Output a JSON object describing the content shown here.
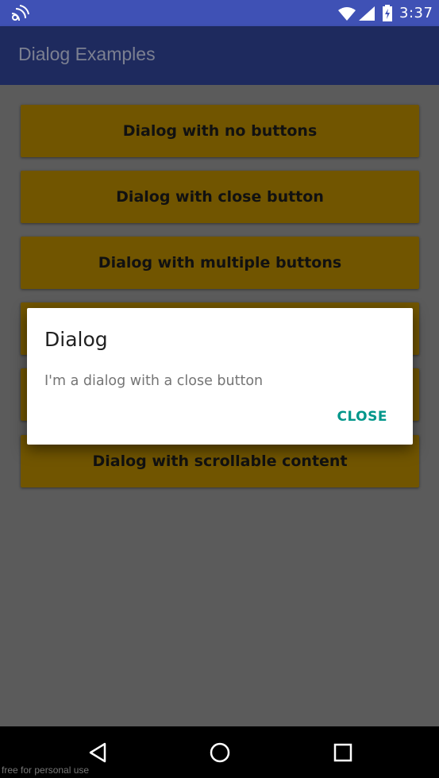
{
  "status_bar": {
    "time": "3:37",
    "icons": [
      "cast-icon",
      "wifi-icon",
      "signal-icon",
      "battery-icon"
    ]
  },
  "app_bar": {
    "title": "Dialog Examples"
  },
  "buttons": [
    {
      "label": "Dialog with no buttons"
    },
    {
      "label": "Dialog with close button"
    },
    {
      "label": "Dialog with multiple buttons"
    },
    {
      "label": ""
    },
    {
      "label": ""
    },
    {
      "label": "Dialog with scrollable content"
    }
  ],
  "dialog": {
    "title": "Dialog",
    "message": "I'm a dialog with a close button",
    "close_label": "CLOSE"
  },
  "nav_bar": {
    "icons": [
      "back-icon",
      "home-icon",
      "recents-icon"
    ]
  },
  "watermark": "free for personal use",
  "colors": {
    "status_bar": "#3f51b5",
    "app_bar": "#1e2a5e",
    "button": "#715500",
    "scrim_background": "#5b5b5b",
    "accent": "#00968a"
  }
}
